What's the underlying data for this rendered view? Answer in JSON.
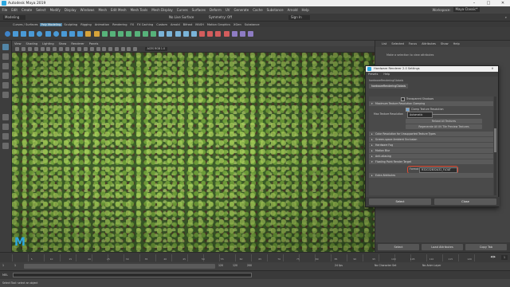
{
  "window": {
    "title": "Autodesk Maya 2019"
  },
  "menus": [
    "File",
    "Edit",
    "Create",
    "Select",
    "Modify",
    "Display",
    "Windows",
    "Mesh",
    "Edit Mesh",
    "Mesh Tools",
    "Mesh Display",
    "Curves",
    "Surfaces",
    "Deform",
    "UV",
    "Generate",
    "Cache",
    "Substance",
    "Arnold",
    "Help"
  ],
  "workspace": {
    "label": "Workspace:",
    "value": "Maya Classic*"
  },
  "status": {
    "mode": "Modeling",
    "live_surface": "No Live Surface",
    "symmetry": "Symmetry: Off",
    "sign_in": "Sign In"
  },
  "shelf_tabs": [
    "Curves / Surfaces",
    "Poly Modeling",
    "Sculpting",
    "Rigging",
    "Animation",
    "Rendering",
    "FX",
    "FX Caching",
    "Custom",
    "Arnold",
    "Bifrost",
    "MASH",
    "Motion Graphics",
    "XGen",
    "Substance"
  ],
  "shelf_active": "Poly Modeling",
  "viewport_menu": [
    "View",
    "Shading",
    "Lighting",
    "Show",
    "Renderer",
    "Panels"
  ],
  "viewport_gamma": "ACES RGB 1.0",
  "attr_editor": {
    "menu": [
      "List",
      "Selected",
      "Focus",
      "Attributes",
      "Show",
      "Help"
    ],
    "hint": "Make a selection to view attributes",
    "select_label": "Select",
    "load_label": "Load Attributes",
    "copy_label": "Copy Tab"
  },
  "dialog": {
    "title": "Hardware Renderer 2.0 Settings",
    "menu": [
      "Presets",
      "Help"
    ],
    "node_label": "hardwareRenderingGlobals",
    "tab_label": "hardwareRenderingGlobals",
    "transparent_shadows": "Transparent Shadows",
    "section_texture": "Maximum Texture Resolution Clamping",
    "clamp_label": "Clamp Texture Resolution",
    "max_res_label": "Max Texture Resolution",
    "max_res_value": "Automatic",
    "reload_label": "Reload All Textures",
    "regenerate_label": "Regenerate All UV Tile Preview Textures",
    "sections": [
      "Color Resolution for Unsupported Texture Types",
      "Screen-space Ambient Occlusion",
      "Hardware Fog",
      "Motion Blur",
      "Anti-aliasing",
      "Floating Point Render Target"
    ],
    "format_label": "Format",
    "format_value": "R32G32B32A32_FLOAT",
    "extra_section": "Extra Attributes",
    "select_button": "Select",
    "close_button": "Close"
  },
  "timeline": {
    "ticks": [
      "5",
      "10",
      "15",
      "20",
      "25",
      "30",
      "35",
      "40",
      "45",
      "50",
      "55",
      "60",
      "65",
      "70",
      "75",
      "80",
      "85",
      "90",
      "95",
      "100",
      "105",
      "110",
      "115",
      "120"
    ],
    "current": "1"
  },
  "range": {
    "start": "1",
    "inner_start": "1",
    "inner_end": "120",
    "end": "120",
    "end2": "200",
    "char_set": "No Character Set",
    "anim_layer": "No Anim Layer",
    "fps": "24 fps"
  },
  "command_line": {
    "lang": "MEL"
  },
  "help_line": "Select Tool: select an object"
}
